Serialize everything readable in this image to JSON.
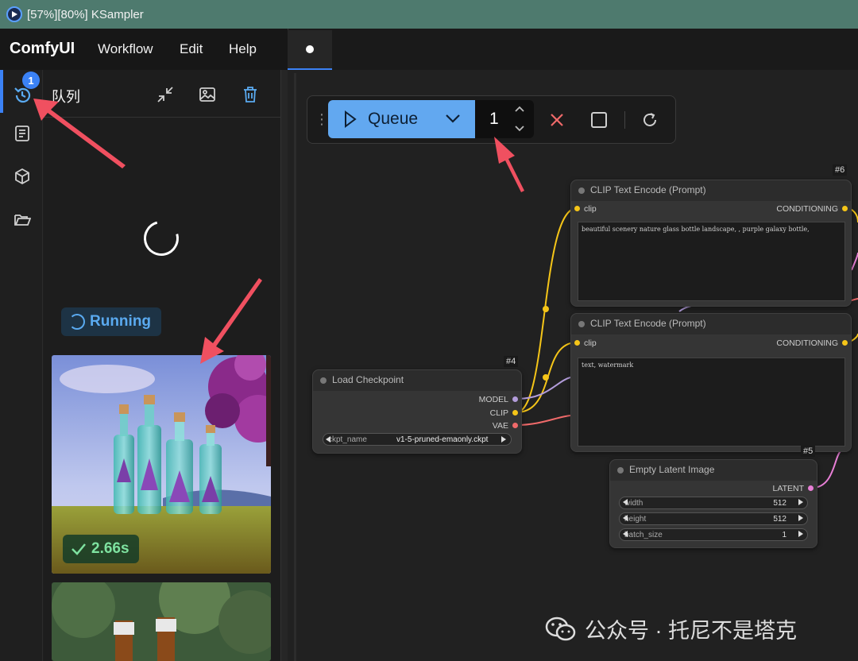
{
  "window": {
    "title": "[57%][80%] KSampler"
  },
  "menu": {
    "logo": "ComfyUI",
    "items": [
      "Workflow",
      "Edit",
      "Help"
    ]
  },
  "sidebar": {
    "queue_badge": "1",
    "icons": [
      "history-icon",
      "library-icon",
      "model-icon",
      "workflow-folder-icon"
    ]
  },
  "queue_panel": {
    "title": "队列",
    "status": "Running",
    "completed_time": "2.66s"
  },
  "toolbar": {
    "queue_label": "Queue",
    "batch_count": "1"
  },
  "nodes": {
    "clip_positive": {
      "id": "#6",
      "title": "CLIP Text Encode (Prompt)",
      "input": "clip",
      "output": "CONDITIONING",
      "text": "beautiful scenery nature glass bottle landscape, , purple galaxy bottle,"
    },
    "clip_negative": {
      "title": "CLIP Text Encode (Prompt)",
      "input": "clip",
      "output": "CONDITIONING",
      "text": "text, watermark"
    },
    "checkpoint": {
      "id": "#4",
      "title": "Load Checkpoint",
      "outputs": [
        "MODEL",
        "CLIP",
        "VAE"
      ],
      "widget_label": "ckpt_name",
      "widget_value": "v1-5-pruned-emaonly.ckpt"
    },
    "latent": {
      "id": "#5",
      "title": "Empty Latent Image",
      "output": "LATENT",
      "widgets": [
        {
          "label": "width",
          "value": "512"
        },
        {
          "label": "height",
          "value": "512"
        },
        {
          "label": "batch_size",
          "value": "1"
        }
      ]
    }
  },
  "watermark": "公众号 · 托尼不是塔克",
  "colors": {
    "accent": "#3b82f6",
    "queue_button": "#62a8f0",
    "title_bar": "#4e7a6e",
    "running": "#5aaaf0",
    "done": "#7ee2a0",
    "arrow": "#f05060"
  }
}
